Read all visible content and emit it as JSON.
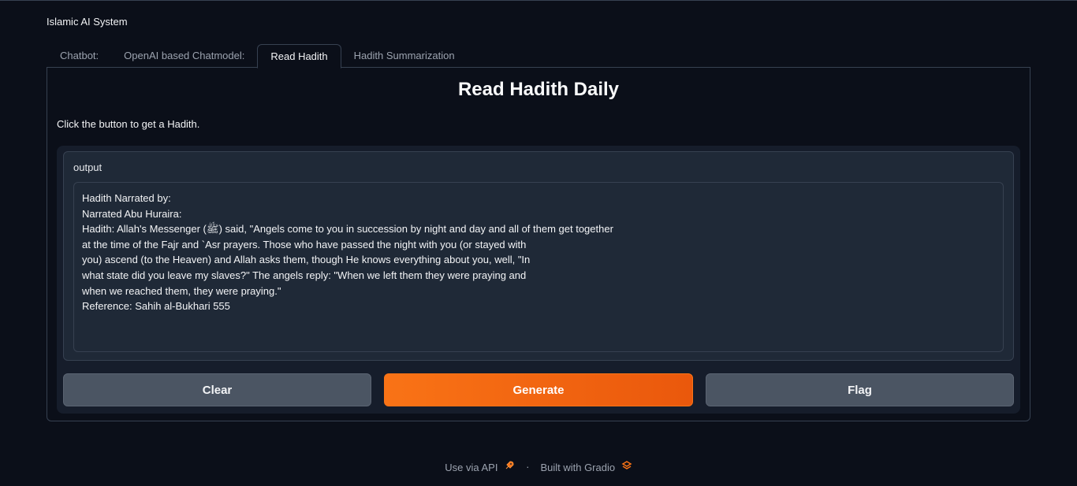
{
  "app": {
    "title": "Islamic AI System"
  },
  "tabs": [
    {
      "label": "Chatbot:"
    },
    {
      "label": "OpenAI based Chatmodel:"
    },
    {
      "label": "Read Hadith"
    },
    {
      "label": "Hadith Summarization"
    }
  ],
  "selected_tab": "Read Hadith",
  "main": {
    "heading": "Read Hadith Daily",
    "instruction": "Click the button to get a Hadith.",
    "output": {
      "label": "output",
      "lines": [
        "Hadith Narrated by:",
        "Narrated Abu Huraira:",
        "Hadith: Allah's Messenger (ﷺ) said, \"Angels come to you in succession by night and day and all of them get together",
        "at the time of the Fajr and `Asr prayers. Those who have passed the night with you (or stayed with",
        "you) ascend (to the Heaven) and Allah asks them, though He knows everything about you, well, \"In",
        "what state did you leave my slaves?\" The angels reply: \"When we left them they were praying and",
        "when we reached them, they were praying.\"",
        "Reference: Sahih al-Bukhari 555"
      ]
    },
    "buttons": {
      "clear": "Clear",
      "generate": "Generate",
      "flag": "Flag"
    }
  },
  "footer": {
    "api_link": "Use via API",
    "separator": "·",
    "built_with": "Built with Gradio"
  },
  "colors": {
    "background": "#0b0f19",
    "accent": "#f97316",
    "secondary_button": "#4b5563"
  }
}
